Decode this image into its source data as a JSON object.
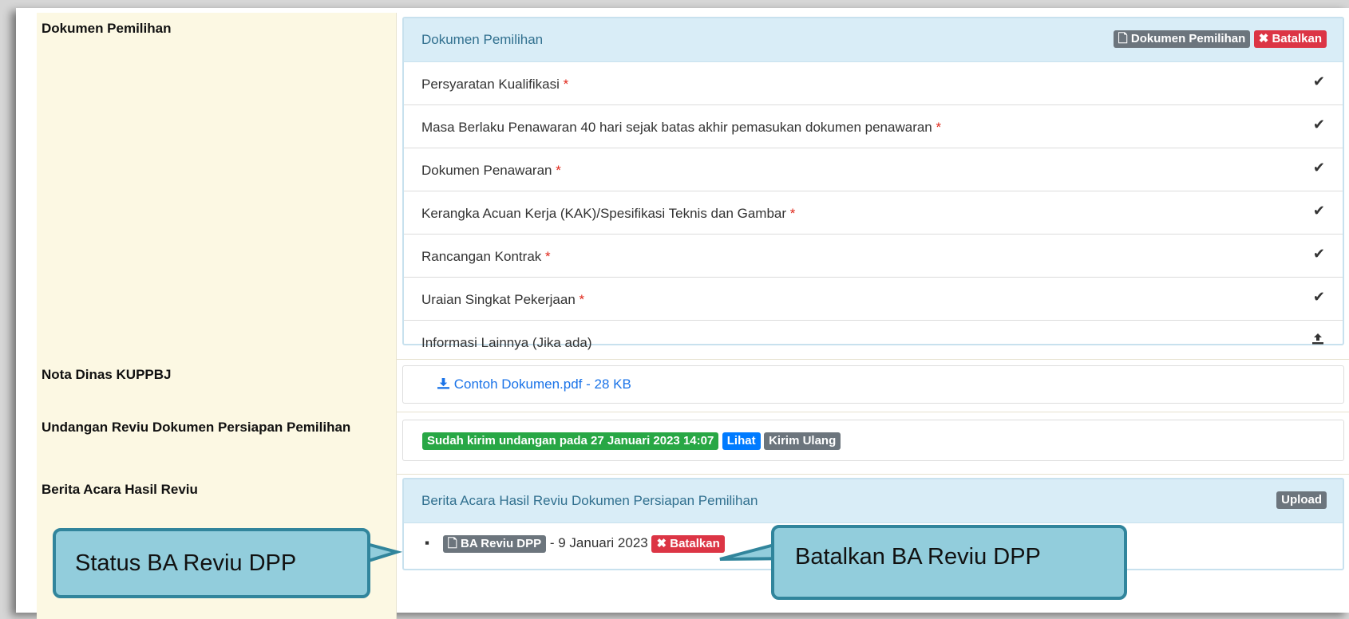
{
  "sections": {
    "dokumen": {
      "label": "Dokumen Pemilihan",
      "panel_title": "Dokumen Pemilihan",
      "doc_button": "Dokumen Pemilihan",
      "cancel_button": "Batalkan",
      "items": [
        {
          "text": "Persyaratan Kualifikasi",
          "required": "*",
          "status": "✔"
        },
        {
          "text": "Masa Berlaku Penawaran 40 hari sejak batas akhir pemasukan dokumen penawaran",
          "required": "*",
          "status": "✔"
        },
        {
          "text": "Dokumen Penawaran",
          "required": "*",
          "status": "✔"
        },
        {
          "text": "Kerangka Acuan Kerja (KAK)/Spesifikasi Teknis dan Gambar",
          "required": "*",
          "status": "✔"
        },
        {
          "text": "Rancangan Kontrak",
          "required": "*",
          "status": "✔"
        },
        {
          "text": "Uraian Singkat Pekerjaan",
          "required": "*",
          "status": "✔"
        },
        {
          "text": "Informasi Lainnya (Jika ada)",
          "required": "",
          "status": "upload-icon"
        }
      ]
    },
    "nota": {
      "label": "Nota Dinas KUPPBJ",
      "file_link": "Contoh Dokumen.pdf - 28 KB"
    },
    "undangan": {
      "label": "Undangan Reviu Dokumen Persiapan Pemilihan",
      "status_badge": "Sudah kirim undangan pada 27 Januari 2023 14:07",
      "view_button": "Lihat",
      "resend_button": "Kirim Ulang"
    },
    "berita": {
      "label": "Berita Acara Hasil Reviu",
      "panel_title": "Berita Acara Hasil Reviu Dokumen Persiapan Pemilihan",
      "upload_button": "Upload",
      "doc_badge": "BA Reviu DPP",
      "doc_date": "- 9 Januari 2023",
      "cancel_button": "Batalkan"
    }
  },
  "callouts": {
    "status": "Status BA Reviu DPP",
    "batalkan": "Batalkan BA Reviu DPP"
  },
  "colors": {
    "label_bg": "#fcf8e3",
    "panel_head": "#d9edf7",
    "callout_fill": "#92cddc",
    "callout_border": "#31859c"
  }
}
